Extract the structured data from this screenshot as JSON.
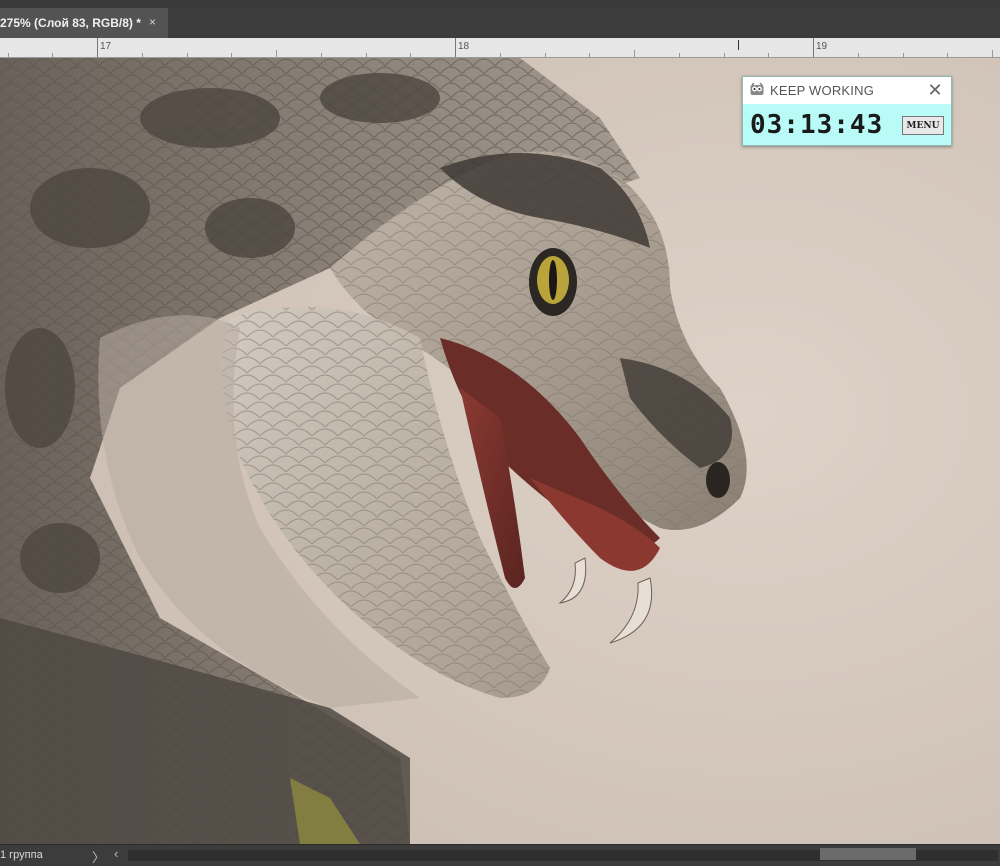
{
  "document_tab": {
    "title": "275% (Слой 83, RGB/8) *",
    "close_glyph": "×"
  },
  "ruler": {
    "labels": [
      "17",
      "18",
      "19"
    ]
  },
  "timer_widget": {
    "title": "KEEP WORKING",
    "icon": "owl-icon",
    "close_glyph": "✕",
    "time": "03:13:43",
    "menu_label": "MENU",
    "background_color": "#b9fbf6"
  },
  "status_bar": {
    "layer_label": "1 группа",
    "expand_glyph": "〉",
    "scroll_left_glyph": "‹"
  },
  "colors": {
    "canvas_background": "#d9cbc0",
    "tab_active": "#535353",
    "chrome": "#3c3c3c"
  }
}
